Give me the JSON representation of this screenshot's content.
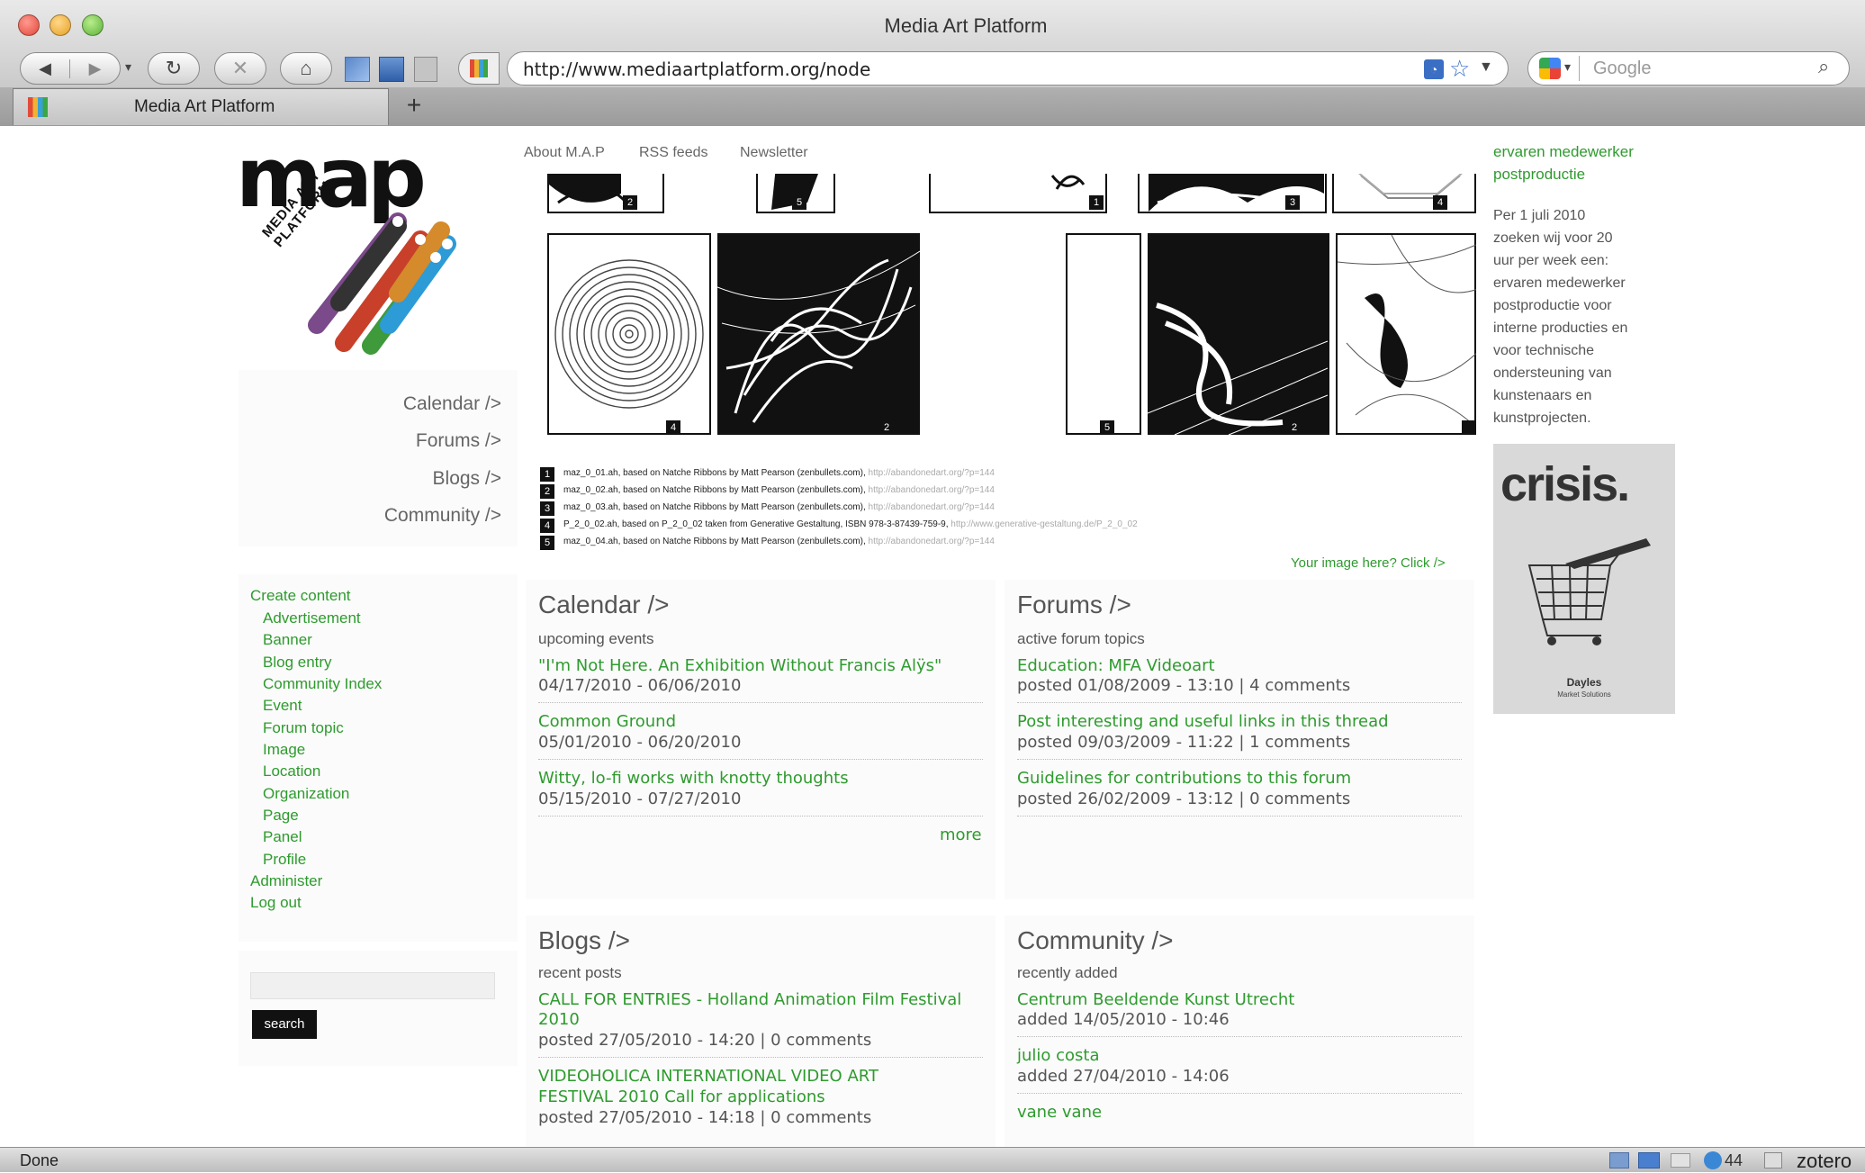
{
  "browser": {
    "window_title": "Media Art Platform",
    "url": "http://www.mediaartplatform.org/node",
    "search_placeholder": "Google",
    "tab_label": "Media Art Platform",
    "new_tab": "+",
    "status": "Done",
    "status_right": [
      "44",
      "zotero"
    ]
  },
  "site": {
    "logo_text": "map",
    "logo_sub": "MEDIA ART PLATFORM",
    "top_nav": [
      "About M.A.P",
      "RSS feeds",
      "Newsletter"
    ],
    "side_nav": [
      "Calendar />",
      "Forums />",
      "Blogs />",
      "Community />"
    ],
    "admin_menu": {
      "create": "Create content",
      "items": [
        "Advertisement",
        "Banner",
        "Blog entry",
        "Community Index",
        "Event",
        "Forum topic",
        "Image",
        "Location",
        "Organization",
        "Page",
        "Panel",
        "Profile"
      ],
      "administer": "Administer",
      "logout": "Log out"
    },
    "search_button": "search"
  },
  "gallery": {
    "top_numbers": [
      "2",
      "5",
      "1",
      "3",
      "4"
    ],
    "mid_numbers": [
      "4",
      "2",
      "5",
      "2",
      ""
    ],
    "captions": [
      {
        "num": "1",
        "text": "maz_0_01.ah, based on Natche Ribbons by Matt Pearson (zenbullets.com),",
        "link": "http://abandonedart.org/?p=144"
      },
      {
        "num": "2",
        "text": "maz_0_02.ah, based on Natche Ribbons by Matt Pearson (zenbullets.com),",
        "link": "http://abandonedart.org/?p=144"
      },
      {
        "num": "3",
        "text": "maz_0_03.ah, based on Natche Ribbons by Matt Pearson (zenbullets.com),",
        "link": "http://abandonedart.org/?p=144"
      },
      {
        "num": "4",
        "text": "P_2_0_02.ah, based on P_2_0_02 taken from Generative Gestaltung, ISBN 978-3-87439-759-9,",
        "link": "http://www.generative-gestaltung.de/P_2_0_02"
      },
      {
        "num": "5",
        "text": "maz_0_04.ah, based on Natche Ribbons by Matt Pearson (zenbullets.com),",
        "link": "http://abandonedart.org/?p=144"
      }
    ],
    "your_image": "Your image here? Click />"
  },
  "calendar": {
    "title": "Calendar />",
    "subtitle": "upcoming events",
    "items": [
      {
        "title": "\"I'm Not Here. An Exhibition Without Francis Alÿs\"",
        "meta": "04/17/2010 - 06/06/2010"
      },
      {
        "title": "Common Ground",
        "meta": "05/01/2010 - 06/20/2010"
      },
      {
        "title": "Witty, lo-fi works with knotty thoughts",
        "meta": "05/15/2010 - 07/27/2010"
      }
    ],
    "more": "more"
  },
  "forums": {
    "title": "Forums />",
    "subtitle": "active forum topics",
    "items": [
      {
        "title": "Education: MFA Videoart",
        "meta": "posted 01/08/2009 - 13:10 | 4 comments"
      },
      {
        "title": "Post interesting and useful links in this thread",
        "meta": "posted 09/03/2009 - 11:22 | 1 comments"
      },
      {
        "title": "Guidelines for contributions to this forum",
        "meta": "posted 26/02/2009 - 13:12 | 0 comments"
      }
    ]
  },
  "blogs": {
    "title": "Blogs />",
    "subtitle": "recent posts",
    "items": [
      {
        "title1": "CALL FOR ENTRIES - Holland Animation Film Festival",
        "title2": "2010",
        "meta": "posted 27/05/2010 - 14:20 | 0 comments"
      },
      {
        "title1": "VIDEOHOLICA INTERNATIONAL VIDEO ART",
        "title2": "FESTIVAL 2010 Call for applications",
        "meta": "posted 27/05/2010 - 14:18 | 0 comments"
      }
    ]
  },
  "community": {
    "title": "Community />",
    "subtitle": "recently added",
    "items": [
      {
        "title": "Centrum Beeldende Kunst Utrecht",
        "meta": "added 14/05/2010 - 10:46"
      },
      {
        "title": "julio costa",
        "meta": "added 27/04/2010 - 14:06"
      },
      {
        "title": "vane vane",
        "meta": ""
      }
    ]
  },
  "job": {
    "title1": "ervaren medewerker",
    "title2": "postproductie",
    "lines": [
      "Per 1 juli 2010",
      "zoeken wij voor 20",
      "uur per week een:",
      "ervaren medewerker",
      "postproductie voor",
      "interne producties en",
      "voor technische",
      "ondersteuning van",
      "kunstenaars en",
      "kunstprojecten."
    ]
  },
  "ad": {
    "headline": "crisis.",
    "brand": "Dayles",
    "tagline": "Market Solutions"
  },
  "colors": {
    "link_green": "#2e9b2e",
    "panel_bg": "#fbfbfb",
    "ad_bg": "#d9d9d9"
  },
  "icons": [
    "back-icon",
    "forward-icon",
    "reload-icon",
    "stop-icon",
    "home-icon",
    "rss-icon",
    "star-icon",
    "search-icon",
    "google-icon"
  ]
}
